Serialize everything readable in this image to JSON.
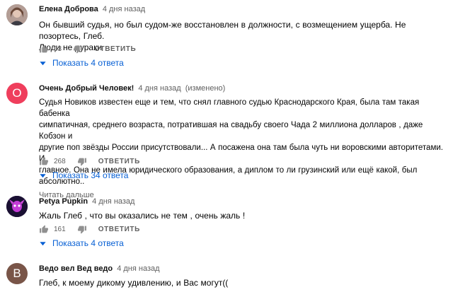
{
  "comments": [
    {
      "author": "Елена Доброва",
      "time": "4 дня назад",
      "edited": "",
      "avatar_color": "#a08c86",
      "avatar_letter": "",
      "lines": [
        "Он бывший судья, но был судом-же восстановлен в должности, с возмещением ущерба. Не позортесь, Глеб.",
        "Люди не дураки"
      ],
      "read_more": "",
      "likes": "63",
      "reply_label": "ОТВЕТИТЬ",
      "show_replies": "Показать 4 ответа"
    },
    {
      "author": "Очень Добрый Человек!",
      "time": "4 дня назад",
      "edited": "(изменено)",
      "avatar_color": "#ef3e5c",
      "avatar_letter": "О",
      "lines": [
        "Судья Новиков известен еще и тем, что снял главного судью Краснодарского Края, была там такая бабенка",
        "симпатичная, среднего возраста, потратившая на свадьбу своего Чада 2 миллиона долларов , даже Кобзон и",
        "другие поп звёзды России присутствовали... А посажена она там была чуть ни воровскими авторитетами. И",
        "главное. Она не имела юридического образования, а диплом то ли грузинский или ещё какой, был абсолютно.."
      ],
      "read_more": "Читать дальше",
      "likes": "268",
      "reply_label": "ОТВЕТИТЬ",
      "show_replies": "Показать 34 ответа"
    },
    {
      "author": "Petya Pupkin",
      "time": "4 дня назад",
      "edited": "",
      "avatar_color": "#1a1033",
      "avatar_letter": "",
      "lines": [
        "Жаль Глеб , что вы оказались не тем , очень жаль !"
      ],
      "read_more": "",
      "likes": "161",
      "reply_label": "ОТВЕТИТЬ",
      "show_replies": "Показать 4 ответа"
    },
    {
      "author": "Ведо вел Вед ведо",
      "time": "4 дня назад",
      "edited": "",
      "avatar_color": "#795548",
      "avatar_letter": "В",
      "lines": [
        "Глеб, к моему дикому удивлению, и Вас могут(("
      ],
      "read_more": "",
      "likes": "",
      "reply_label": "",
      "show_replies": ""
    }
  ]
}
